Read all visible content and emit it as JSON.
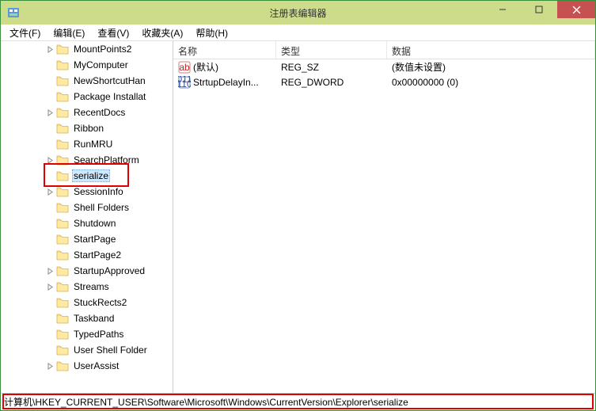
{
  "window": {
    "title": "注册表编辑器"
  },
  "menu": {
    "file": "文件(F)",
    "edit": "编辑(E)",
    "view": "查看(V)",
    "favorites": "收藏夹(A)",
    "help": "帮助(H)"
  },
  "tree": {
    "items": [
      {
        "label": "MountPoints2",
        "exp": "closed"
      },
      {
        "label": "MyComputer",
        "exp": "none"
      },
      {
        "label": "NewShortcutHan",
        "exp": "none"
      },
      {
        "label": "Package Installat",
        "exp": "none"
      },
      {
        "label": "RecentDocs",
        "exp": "closed"
      },
      {
        "label": "Ribbon",
        "exp": "none"
      },
      {
        "label": "RunMRU",
        "exp": "none"
      },
      {
        "label": "SearchPlatform",
        "exp": "closed"
      },
      {
        "label": "serialize",
        "exp": "none",
        "selected": true
      },
      {
        "label": "SessionInfo",
        "exp": "closed"
      },
      {
        "label": "Shell Folders",
        "exp": "none"
      },
      {
        "label": "Shutdown",
        "exp": "none"
      },
      {
        "label": "StartPage",
        "exp": "none"
      },
      {
        "label": "StartPage2",
        "exp": "none"
      },
      {
        "label": "StartupApproved",
        "exp": "closed"
      },
      {
        "label": "Streams",
        "exp": "closed"
      },
      {
        "label": "StuckRects2",
        "exp": "none"
      },
      {
        "label": "Taskband",
        "exp": "none"
      },
      {
        "label": "TypedPaths",
        "exp": "none"
      },
      {
        "label": "User Shell Folder",
        "exp": "none"
      },
      {
        "label": "UserAssist",
        "exp": "closed"
      }
    ]
  },
  "list": {
    "headers": {
      "name": "名称",
      "type": "类型",
      "data": "数据"
    },
    "rows": [
      {
        "icon": "string",
        "name": "(默认)",
        "type": "REG_SZ",
        "data": "(数值未设置)"
      },
      {
        "icon": "binary",
        "name": "StrtupDelayIn...",
        "type": "REG_DWORD",
        "data": "0x00000000 (0)"
      }
    ]
  },
  "statusbar": {
    "path": "计算机\\HKEY_CURRENT_USER\\Software\\Microsoft\\Windows\\CurrentVersion\\Explorer\\serialize"
  }
}
